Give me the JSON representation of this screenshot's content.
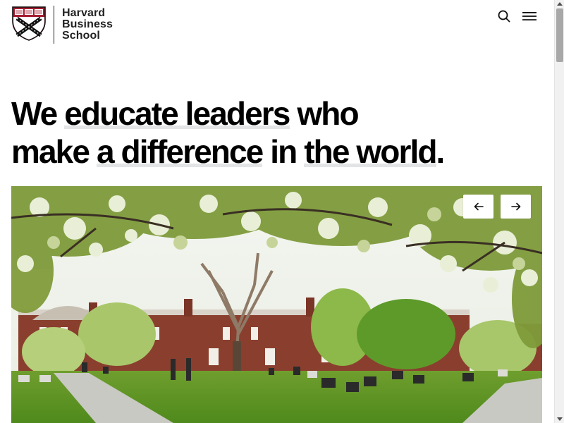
{
  "header": {
    "wordmark": [
      "Harvard",
      "Business",
      "School"
    ],
    "icons": {
      "logo": "hbs-shield-icon",
      "search": "search-icon",
      "menu": "hamburger-menu-icon"
    }
  },
  "hero": {
    "headline_line1": [
      {
        "text": "We ",
        "highlight": false
      },
      {
        "text": "educate leaders",
        "highlight": true
      },
      {
        "text": " who",
        "highlight": false
      }
    ],
    "headline_line2": [
      {
        "text": "make ",
        "highlight": false
      },
      {
        "text": "a difference",
        "highlight": true
      },
      {
        "text": " in ",
        "highlight": false
      },
      {
        "text": "the world",
        "highlight": true
      },
      {
        "text": ".",
        "highlight": false
      }
    ]
  },
  "carousel": {
    "prev_icon": "arrow-left-icon",
    "next_icon": "arrow-right-icon"
  },
  "colors": {
    "brand_crimson": "#a51c30",
    "text": "#000000",
    "highlight": "#e3e4e6"
  }
}
